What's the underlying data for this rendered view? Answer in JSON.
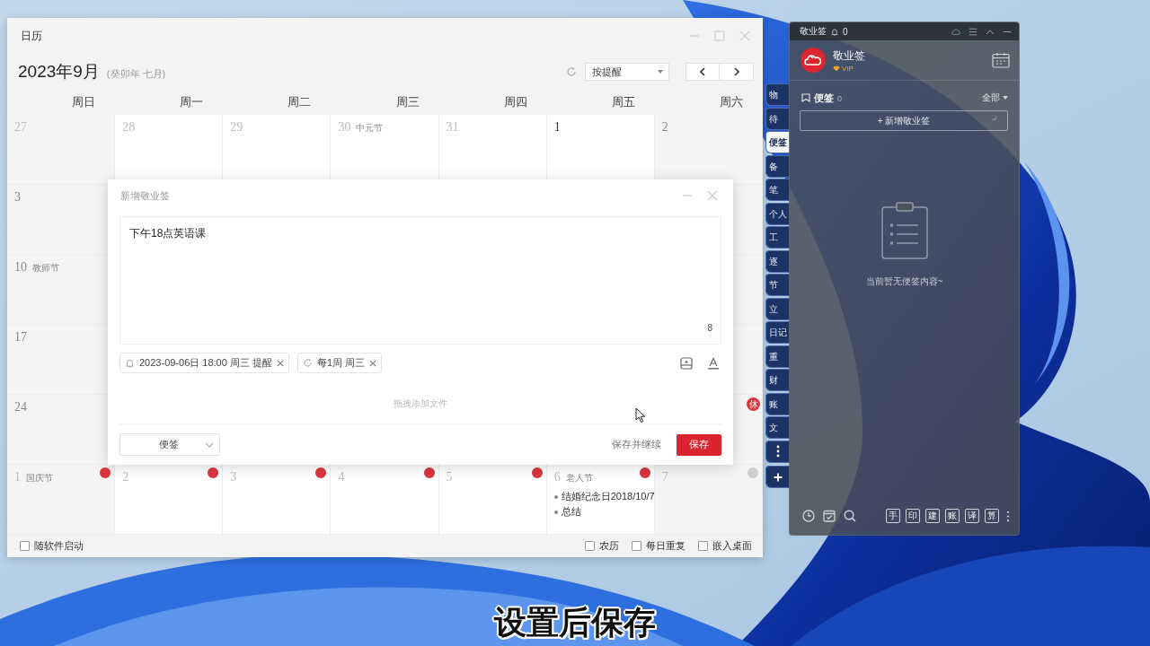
{
  "calendar_window": {
    "title": "日历",
    "month": "2023年9月",
    "lunar": "(癸卯年 七月)",
    "view_select": "按提醒",
    "weekdays": [
      "周日",
      "周一",
      "周二",
      "周三",
      "周四",
      "周五",
      "周六"
    ],
    "weeks": [
      {
        "sun": {
          "date": "27",
          "muted": true
        },
        "mon": {
          "date": "28",
          "muted": true
        },
        "tue": {
          "date": "29",
          "muted": true
        },
        "wed": {
          "date": "30",
          "muted": true,
          "festival": "中元节"
        },
        "thu": {
          "date": "31",
          "muted": true
        },
        "fri": {
          "date": "1",
          "muted": false
        },
        "sat": {
          "date": "2",
          "muted": false
        }
      },
      {
        "sun": {
          "date": "3",
          "muted": false
        }
      },
      {
        "sun": {
          "date": "10",
          "muted": false,
          "festival": "教师节"
        }
      },
      {
        "sun": {
          "date": "17",
          "muted": false
        }
      },
      {
        "sun": {
          "date": "24",
          "muted": false
        },
        "sat": {
          "badge": {
            "kind": "rest",
            "text": "休"
          }
        }
      },
      {
        "sun": {
          "date": "1",
          "muted": true,
          "festival": "国庆节",
          "badge": {
            "kind": "rest"
          }
        },
        "mon": {
          "date": "2",
          "muted": true,
          "badge": {
            "kind": "rest"
          }
        },
        "tue": {
          "date": "3",
          "muted": true,
          "badge": {
            "kind": "rest"
          }
        },
        "wed": {
          "date": "4",
          "muted": true,
          "badge": {
            "kind": "rest"
          }
        },
        "thu": {
          "date": "5",
          "muted": true,
          "badge": {
            "kind": "rest"
          }
        },
        "fri": {
          "date": "6",
          "muted": true,
          "festival": "老人节",
          "badge": {
            "kind": "rest"
          },
          "events": [
            "结婚纪念日2018/10/7",
            "总结"
          ]
        },
        "sat": {
          "date": "7",
          "muted": true,
          "badge": {
            "kind": "work"
          }
        }
      }
    ],
    "footer": {
      "left": [
        {
          "label": "随软件启动",
          "checked": false
        }
      ],
      "right": [
        {
          "label": "农历",
          "checked": false
        },
        {
          "label": "每日重复",
          "checked": false
        },
        {
          "label": "嵌入桌面",
          "checked": false
        }
      ]
    }
  },
  "new_note_dialog": {
    "title": "新增敬业签",
    "content": "下午18点英语课",
    "char_count": "8",
    "tags": [
      {
        "kind": "reminder",
        "label": "2023-09-06日 18:00 周三 提醒"
      },
      {
        "kind": "repeat",
        "label": "每1周 周三"
      }
    ],
    "drop_hint": "拖拽添加文件",
    "category_select": "便签",
    "buttons": [
      {
        "kind": "text",
        "label": "保存并继续"
      },
      {
        "kind": "primary",
        "label": "保存"
      }
    ]
  },
  "notes_panel": {
    "title": "敬业签",
    "bell_count": "0",
    "user": {
      "name": "敬业签",
      "badge": "VIP"
    },
    "tabs": [
      {
        "label": "物",
        "selected": false
      },
      {
        "label": "待",
        "selected": false
      },
      {
        "label": "便签",
        "selected": true
      },
      {
        "label": "备",
        "selected": false
      },
      {
        "label": "笔",
        "selected": false
      },
      {
        "label": "个人",
        "selected": false
      },
      {
        "label": "工",
        "selected": false
      },
      {
        "label": "逐",
        "selected": false
      },
      {
        "label": "节",
        "selected": false
      },
      {
        "label": "立",
        "selected": false
      },
      {
        "label": "日记",
        "selected": false
      },
      {
        "label": "重",
        "selected": false
      },
      {
        "label": "财",
        "selected": false
      },
      {
        "label": "账",
        "selected": false
      },
      {
        "label": "文",
        "selected": false
      }
    ],
    "section": {
      "label": "便签",
      "count": "0",
      "filter": "全部"
    },
    "add_button": "+ 新增敬业签",
    "empty_text": "当前暂无便签内容~",
    "tools": [
      "手",
      "印",
      "建",
      "账",
      "译",
      "算"
    ]
  },
  "subtitle": "设置后保存"
}
